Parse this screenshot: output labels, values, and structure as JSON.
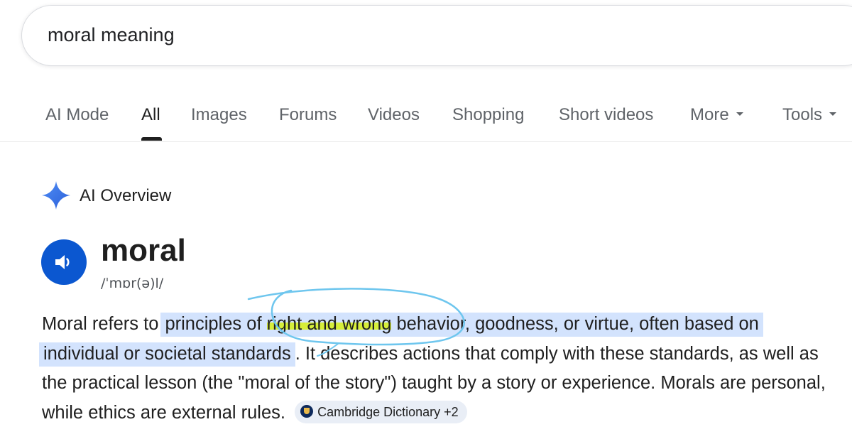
{
  "search": {
    "query": "moral meaning"
  },
  "tabs": [
    {
      "label": "AI Mode"
    },
    {
      "label": "All"
    },
    {
      "label": "Images"
    },
    {
      "label": "Forums"
    },
    {
      "label": "Videos"
    },
    {
      "label": "Shopping"
    },
    {
      "label": "Short videos"
    },
    {
      "label": "More"
    },
    {
      "label": "Tools"
    }
  ],
  "active_tab": "All",
  "ai_overview": {
    "title": "AI Overview",
    "word": "moral",
    "phonetic": "/ˈmɒr(ə)l/",
    "paragraph": {
      "lead": "Moral refers to ",
      "highlight_before": "principles of ",
      "highlight_marked": "right and wrong",
      "highlight_after": " behavior, goodness, or virtue, often based on individual or societal standards",
      "rest": ". It describes actions that comply with these standards, as well as the practical lesson (the \"moral of the story\") taught by a story or experience. Morals are personal, while ethics are external rules. "
    },
    "source_chip": "Cambridge Dictionary +2"
  },
  "colors": {
    "accent_blue": "#0b57d0",
    "selection_highlight": "#d3e3fd",
    "marker_yellow": "#d7ee3a",
    "annotation_pen": "#6ec6ee"
  },
  "icons": {
    "ai_overview": "sparkle-icon",
    "pronounce": "speaker-icon",
    "source": "cambridge-logo-icon"
  }
}
